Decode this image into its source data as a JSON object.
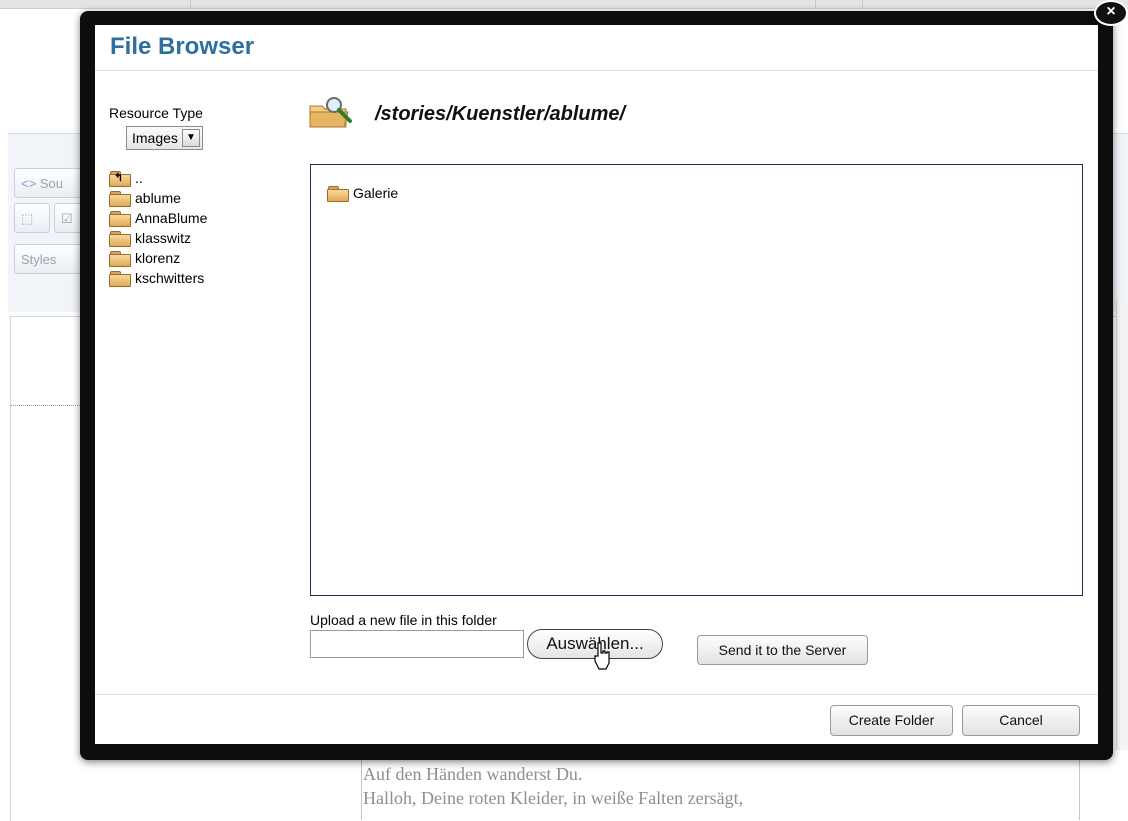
{
  "background": {
    "toolbar": {
      "source_label": "Sou",
      "styles_label": "Styles"
    },
    "content_lines": [
      "Auf den Händen wanderst Du.",
      "Halloh, Deine roten Kleider, in weiße Falten zersägt,"
    ]
  },
  "dialog": {
    "title": "File Browser",
    "close_icon": "close-icon",
    "resource_type": {
      "label": "Resource Type",
      "selected": "Images"
    },
    "folders": [
      {
        "label": "..",
        "icon": "folder-up-icon"
      },
      {
        "label": "ablume",
        "icon": "folder-icon"
      },
      {
        "label": "AnnaBlume",
        "icon": "folder-icon"
      },
      {
        "label": "klasswitz",
        "icon": "folder-icon"
      },
      {
        "label": "klorenz",
        "icon": "folder-icon"
      },
      {
        "label": "kschwitters",
        "icon": "folder-icon"
      }
    ],
    "current_path": "/stories/Kuenstler/ablume/",
    "files": [
      {
        "label": "Galerie",
        "icon": "folder-icon"
      }
    ],
    "upload": {
      "label": "Upload a new file in this folder",
      "file_value": "",
      "browse_label": "Auswählen...",
      "send_label": "Send it to the Server"
    },
    "footer": {
      "create_folder_label": "Create Folder",
      "cancel_label": "Cancel"
    }
  },
  "colors": {
    "title": "#2d6f9d",
    "frame": "#0d0d0d",
    "pane_border": "#1f2f4f",
    "folder": "#e3a955"
  }
}
